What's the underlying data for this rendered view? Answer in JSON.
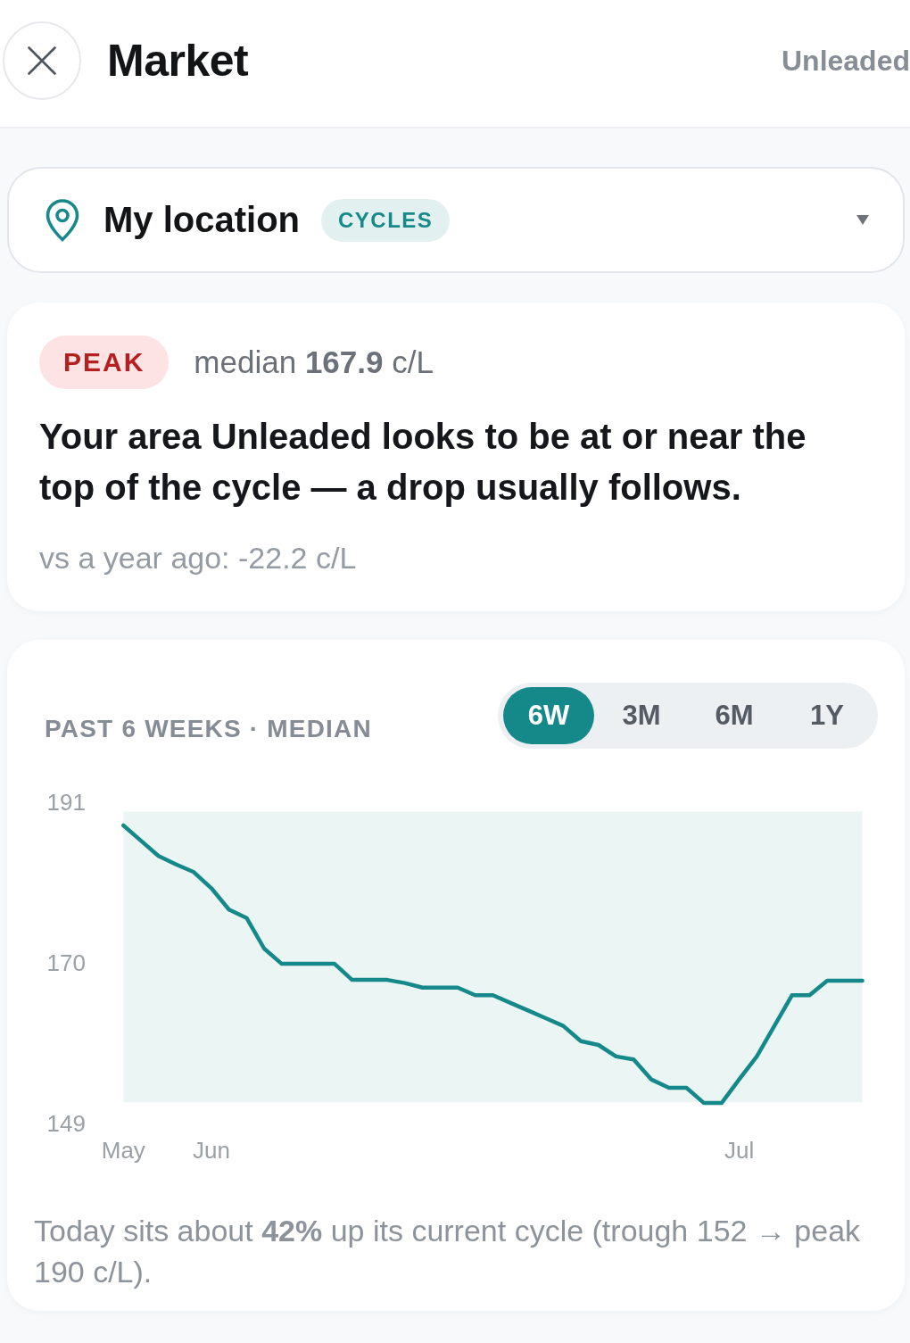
{
  "header": {
    "title": "Market",
    "fuel": "Unleaded"
  },
  "location": {
    "name": "My location",
    "badge": "CYCLES"
  },
  "status": {
    "phase": "PEAK",
    "kind": "peak",
    "median": "median **167.9** c/L",
    "message": "Your area Unleaded looks to be at or near the top of the cycle — a drop usually follows.",
    "comparison": "vs a year ago: -22.2 c/L"
  },
  "history": {
    "title": "PAST 6 WEEKS · MEDIAN",
    "ranges": [
      {
        "label": "6W",
        "selected": true
      },
      {
        "label": "3M",
        "selected": false
      },
      {
        "label": "6M",
        "selected": false
      },
      {
        "label": "1Y",
        "selected": false
      }
    ],
    "chart_data": {
      "type": "line",
      "categories": [
        "May",
        null,
        null,
        null,
        null,
        "Jun",
        null,
        null,
        null,
        null,
        null,
        null,
        null,
        null,
        null,
        null,
        null,
        null,
        null,
        null,
        null,
        null,
        null,
        null,
        null,
        null,
        null,
        null,
        null,
        null,
        null,
        null,
        null,
        null,
        null,
        "Jul",
        null,
        null,
        null,
        null,
        null,
        null,
        null
      ],
      "values": [
        188.2,
        186.2,
        184.2,
        183.1,
        182.1,
        180.0,
        177.2,
        176.1,
        172.1,
        170.1,
        170.1,
        170.1,
        170.1,
        168.0,
        168.0,
        168.0,
        167.6,
        167.0,
        167.0,
        167.0,
        166.0,
        166.0,
        165.0,
        164.0,
        163.0,
        162.0,
        160.0,
        159.5,
        158.0,
        157.6,
        155.0,
        153.9,
        153.9,
        151.9,
        151.9,
        155.0,
        158.0,
        162.0,
        166.0,
        166.0,
        167.9,
        167.9,
        167.9
      ],
      "ylim": [
        149,
        191
      ],
      "yticks": [
        149,
        170,
        191
      ],
      "bands": [
        {
          "axis": "y",
          "from": 152,
          "to": 190
        }
      ]
    },
    "note": "Today sits about **42%** up its current cycle (trough 152 → peak 190 c/L)."
  }
}
